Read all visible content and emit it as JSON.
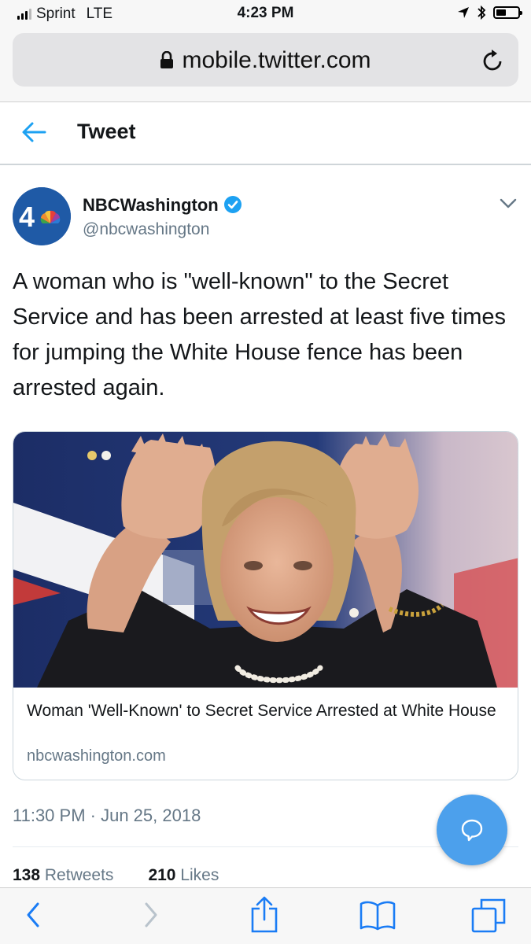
{
  "status_bar": {
    "carrier": "Sprint",
    "network": "LTE",
    "time": "4:23 PM"
  },
  "browser": {
    "url": "mobile.twitter.com"
  },
  "header": {
    "title": "Tweet"
  },
  "tweet": {
    "author_name": "NBCWashington",
    "author_handle": "@nbcwashington",
    "text": "A woman who is \"well-known\" to the Secret Service and has been arrested at least five times for jumping the White House fence has been arrested again.",
    "card": {
      "title": "Woman 'Well-Known' to Secret Service Arrested at White House",
      "domain": "nbcwashington.com"
    },
    "timestamp": "11:30 PM · Jun 25, 2018",
    "retweets_count": "138",
    "retweets_label": "Retweets",
    "likes_count": "210",
    "likes_label": "Likes"
  },
  "avatar_label": "4",
  "colors": {
    "accent": "#1da1f2",
    "compose_button": "#4ca0ec",
    "safari_blue": "#1a7cf5",
    "secondary_text": "#657786"
  },
  "icons": [
    "location-arrow-icon",
    "bluetooth-icon",
    "battery-icon",
    "lock-icon",
    "reload-icon",
    "back-arrow-icon",
    "verified-badge-icon",
    "chevron-down-icon",
    "compose-reply-icon",
    "browser-back-icon",
    "browser-forward-icon",
    "share-icon",
    "bookmarks-icon",
    "tabs-icon"
  ]
}
